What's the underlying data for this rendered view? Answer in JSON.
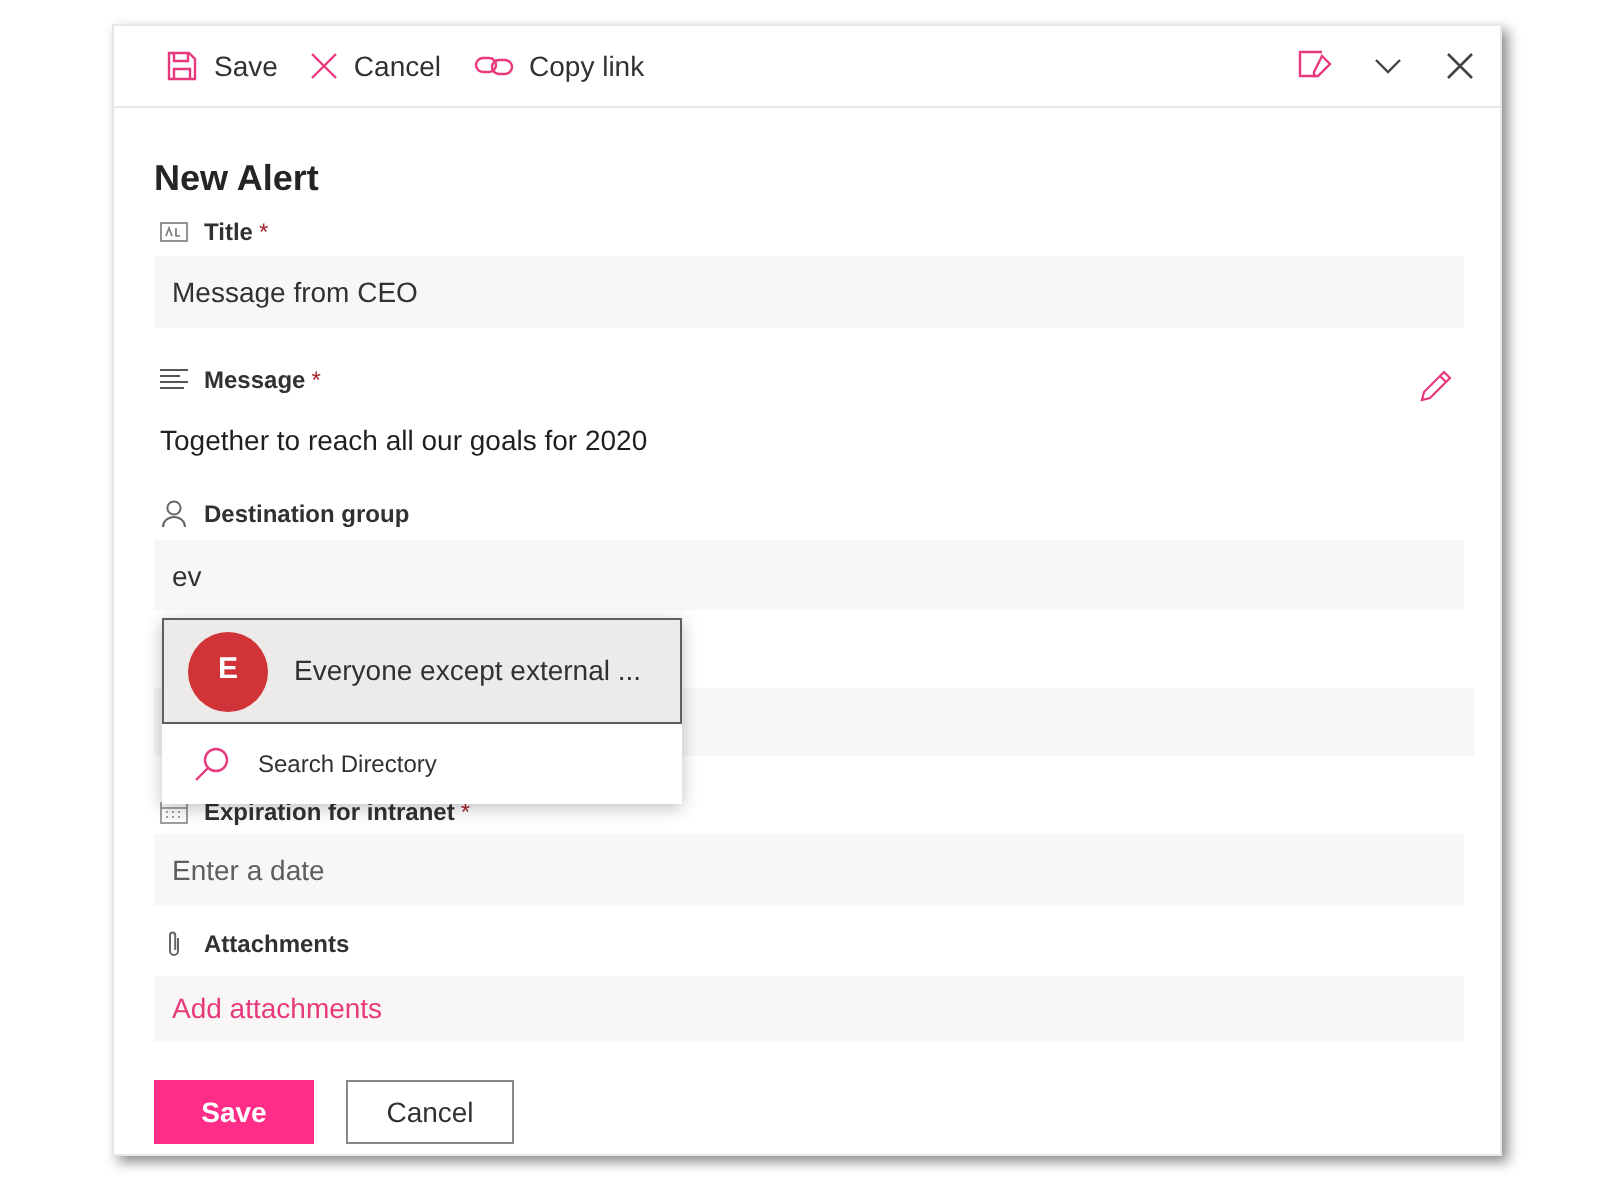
{
  "command_bar": [
    {
      "kind": "save",
      "label": "Save"
    },
    {
      "kind": "cancel",
      "label": "Cancel"
    },
    {
      "kind": "link",
      "label": "Copy link"
    }
  ],
  "form_title": "New Alert",
  "fields": [
    {
      "kind": "text",
      "label": "Title",
      "required_mark": "*",
      "value": "Message from CEO"
    },
    {
      "kind": "multiline",
      "label": "Message",
      "required_mark": "*",
      "value": "Together to reach all our goals for 2020"
    },
    {
      "kind": "person",
      "label": "Destination group",
      "value": "ev"
    },
    {
      "kind": "covered"
    },
    {
      "kind": "date",
      "label": "Expiration for intranet",
      "required_mark": "*",
      "placeholder": "Enter a date"
    },
    {
      "kind": "attachments",
      "label": "Attachments",
      "link": "Add attachments"
    }
  ],
  "suggestions": {
    "items": [
      {
        "initial": "E",
        "name": "Everyone except external ...",
        "selected": true
      }
    ],
    "search": "Search Directory"
  },
  "buttons": [
    {
      "kind": "primary",
      "label": "Save"
    },
    {
      "kind": "secondary",
      "label": "Cancel"
    }
  ]
}
